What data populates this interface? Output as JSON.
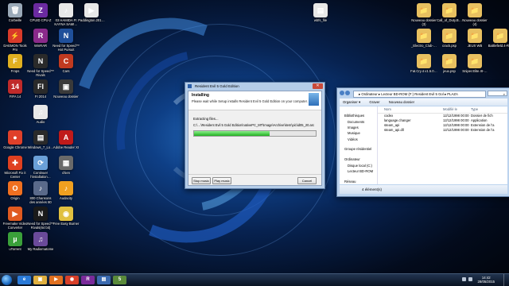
{
  "desktop": {
    "icons": [
      {
        "label": "Corbeille",
        "glyph": "🗑",
        "color": "#9aa9b8"
      },
      {
        "label": "CPUID CPU-Z",
        "glyph": "Z",
        "color": "#6b2aa0"
      },
      {
        "label": "03 HAMIDA Ft KAYNA SAMI…",
        "glyph": "♪",
        "color": "#e8e8e8"
      },
      {
        "label": "Paddington.201…",
        "glyph": "▶",
        "color": "#e8e8e8"
      },
      {
        "label": "DAEMON Tools Pro",
        "glyph": "⚡",
        "color": "#d83a2a"
      },
      {
        "label": "WinRAR",
        "glyph": "R",
        "color": "#8a2a8a"
      },
      {
        "label": "Need for Speed™ Hot Pursuit",
        "glyph": "N",
        "color": "#1f4f9a"
      },
      {
        "label": "Frops",
        "glyph": "F",
        "color": "#e0b020"
      },
      {
        "label": "Need for Speed™ Rivals",
        "glyph": "N",
        "color": "#2a2a2a"
      },
      {
        "label": "Cars",
        "glyph": "C",
        "color": "#c03a20"
      },
      {
        "label": "FIFA 14",
        "glyph": "14",
        "color": "#c02a2a"
      },
      {
        "label": "FI 2014",
        "glyph": "FI",
        "color": "#2a2a2a"
      },
      {
        "label": "Nouveau dossier",
        "glyph": "▣",
        "color": "#3a3a3a"
      },
      {
        "label": "Audio",
        "glyph": "♫",
        "color": "#e8e8e8"
      },
      {
        "label": "Google Chrome",
        "glyph": "●",
        "color": "#e0402a"
      },
      {
        "label": "Windows_7_Lo…",
        "glyph": "▤",
        "color": "#2a2a2a"
      },
      {
        "label": "Adobe Reader XI",
        "glyph": "A",
        "color": "#c01a1a"
      },
      {
        "label": "Microsoft Fix it Center",
        "glyph": "✚",
        "color": "#e04020"
      },
      {
        "label": "Continuer l'installation…",
        "glyph": "⟳",
        "color": "#6aa0d8"
      },
      {
        "label": "chien",
        "glyph": "▦",
        "color": "#6a6a6a"
      },
      {
        "label": "Origin",
        "glyph": "O",
        "color": "#f07020"
      },
      {
        "label": "800 Chansons des années 80",
        "glyph": "♪",
        "color": "#5a6a8a"
      },
      {
        "label": "Audacity",
        "glyph": "♪",
        "color": "#f0a020"
      },
      {
        "label": "Freemake Video Converter",
        "glyph": "▶",
        "color": "#e05a20"
      },
      {
        "label": "Need for Speed™ Rivals(64 bit)",
        "glyph": "N",
        "color": "#1a1a1a"
      },
      {
        "label": "Free Easy Burner",
        "glyph": "◉",
        "color": "#e0c040"
      },
      {
        "label": "uTorrent",
        "glyph": "µ",
        "color": "#3aa03a"
      },
      {
        "label": "My Radiomatome",
        "glyph": "♫",
        "color": "#6a4a9a"
      },
      {
        "label": "wbfs_file",
        "glyph": "▤",
        "color": "#e8e8e8"
      },
      {
        "label": "Nouveau dossier (3)",
        "glyph": "📁",
        "color": "#e8c060"
      },
      {
        "label": "Call_of_Duty.B…",
        "glyph": "📁",
        "color": "#e8c060"
      },
      {
        "label": "_Electro_Club-…",
        "glyph": "📁",
        "color": "#e8c060"
      },
      {
        "label": "crack.psp",
        "glyph": "📁",
        "color": "#e8c060"
      },
      {
        "label": "JEUX WB",
        "glyph": "📁",
        "color": "#e8c060"
      },
      {
        "label": "Nouveau dossier (4)",
        "glyph": "📁",
        "color": "#e8c060"
      },
      {
        "label": "Battlefield.4-R…",
        "glyph": "📁",
        "color": "#e8c060"
      },
      {
        "label": "Fat.Cry.4.v1.5.0…",
        "glyph": "📁",
        "color": "#e8c060"
      },
      {
        "label": "jeux.psp",
        "glyph": "📁",
        "color": "#e8c060"
      },
      {
        "label": "Sniper.Elite.III-…",
        "glyph": "📁",
        "color": "#e8c060"
      }
    ]
  },
  "installer": {
    "title": "Resident Evil 5 Gold Edition",
    "heading": "Installing",
    "subheading": "Please wait while Setup installs Resident Evil 5 Gold Edition on your computer.",
    "status": "Extracting files...",
    "path": "C:\\…\\Resident Evil 5 Gold Edition\\nativePC_MT\\Image\\Archive\\item\\pic\\id05_20.arc",
    "progress_fraction": 0.62,
    "stop_music": "Stop music",
    "play_music": "Play music",
    "cancel": "Cancel"
  },
  "explorer": {
    "address": "▸ Ordinateur ▸ Lecteur BD-ROM (F:) Resident Evil 5 Gol ▸ PLAZA",
    "search_placeholder": "⌕",
    "commands": [
      "Organiser ▾",
      "Graver",
      "Nouveau dossier"
    ],
    "sidebar": [
      "Bibliothèques",
      "Documents",
      "Images",
      "Musique",
      "Vidéos",
      "",
      "Groupe résidentiel",
      "",
      "Ordinateur",
      "Disque local (C:)",
      "Lecteur BD-ROM",
      "",
      "Réseau"
    ],
    "columns": [
      "Nom",
      "Modifié le",
      "Type"
    ],
    "files": [
      {
        "name": "codex",
        "modified": "12/12/1998 00:00",
        "type": "Dossier de fich"
      },
      {
        "name": "language.changer",
        "modified": "12/12/1998 00:00",
        "type": "Application"
      },
      {
        "name": "steam_api",
        "modified": "12/12/1998 00:00",
        "type": "Extension de l'a"
      },
      {
        "name": "steam_api.dll",
        "modified": "12/12/1998 00:00",
        "type": "Extension de l'a"
      }
    ],
    "status": "4 élément(s)"
  },
  "taskbar": {
    "time": "14:42",
    "date": "28/05/2015",
    "apps": [
      {
        "glyph": "e",
        "color": "#2a7ad8"
      },
      {
        "glyph": "▣",
        "color": "#e0b040"
      },
      {
        "glyph": "▶",
        "color": "#e07020"
      },
      {
        "glyph": "◉",
        "color": "#d8402a"
      },
      {
        "glyph": "R",
        "color": "#7a2a9a"
      },
      {
        "glyph": "▤",
        "color": "#3a6ab0"
      },
      {
        "glyph": "5",
        "color": "#5a8a3a"
      }
    ]
  }
}
